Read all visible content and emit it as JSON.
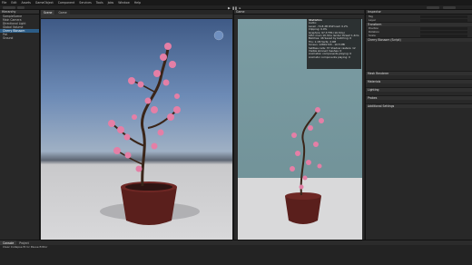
{
  "menubar": {
    "items": [
      "File",
      "Edit",
      "Assets",
      "GameObject",
      "Component",
      "Services",
      "Tools",
      "Jobs",
      "Window",
      "Help"
    ]
  },
  "hierarchy": {
    "tab_label": "Hierarchy",
    "rows": [
      "SampleScene",
      "Main Camera",
      "Directional Light",
      "Global Volume",
      "Cherry Blossom",
      "Pot",
      "Ground"
    ]
  },
  "scene": {
    "tabs": [
      "Scene",
      "Game"
    ]
  },
  "game": {
    "tab_label": "Game",
    "stats_title": "Statistics",
    "stats_lines": [
      "Audio:",
      "Level: -74.8 dB   DSP load: 0.2%",
      "Clipping: 0.0%",
      "Graphics:   97.3 FPS (10.3ms)",
      "CPU: main 10.3ms  render thread 1.4ms",
      "Batches: 46   Saved by batching: 0",
      "Tris: 1.1M   Verts: 2.0M",
      "Screen: 1280x720 - 10.5 MB",
      "SetPass calls: 37   Shadow casters: 12",
      "Visible skinned meshes: 0",
      "Animation components playing: 0",
      "Animator components playing: 0"
    ]
  },
  "inspector": {
    "tab_label": "Inspector",
    "rows": [
      "Tag",
      "Layer",
      "Transform",
      "Position",
      "Rotation",
      "Scale"
    ],
    "sections": [
      "Cherry Blossom (Script)",
      "Mesh Renderer",
      "Materials",
      "Lighting",
      "Probes",
      "Additional Settings"
    ]
  },
  "console": {
    "tabs": [
      "Console",
      "Project"
    ],
    "message": "Clear   Collapse   Error Pause   Editor"
  },
  "colors": {
    "accent": "#2c5d87",
    "blossom": "#e47fa6"
  }
}
